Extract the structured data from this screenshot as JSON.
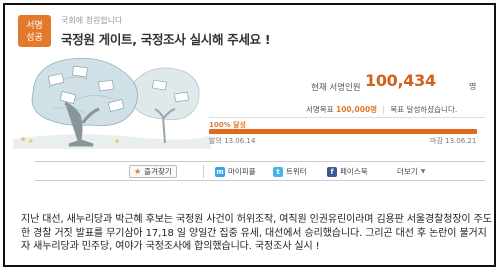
{
  "header": {
    "badge_line1": "서명",
    "badge_line2": "성공",
    "subtitle": "국회에 청원합니다",
    "title": "국정원 게이트, 국정조사 실시해 주세요 !"
  },
  "stats": {
    "count_label": "현재 서명인원",
    "count_value": "100,434",
    "count_unit": "명",
    "goal_label": "서명목표",
    "goal_value": "100,000명",
    "goal_status": "목표 달성하셨습니다.",
    "progress_label": "100% 달성",
    "progress_fraction": 1.0,
    "start_label": "발의",
    "start_date": "13.06.14",
    "end_label": "마감",
    "end_date": "13.06.21"
  },
  "social": {
    "favorite": "즐겨찾기",
    "me2day": "마이피플",
    "twitter": "트위터",
    "facebook": "페이스북",
    "more": "더보기",
    "colors": {
      "me2day": "#3aa3e3",
      "twitter": "#44b6e8",
      "facebook": "#3b5998"
    }
  },
  "content": {
    "text": "지난 대선, 새누리당과 박근혜 후보는 국정원 사건이 허위조작, 여직원 인권유린이라며 김용판 서울경찰청장이 주도한 경찰 거짓 발표를 무기삼아 17,18 일 양일간 집중 유세, 대선에서 승리했습니다. 그리곤 대선 후 논란이 불거지자 새누리당과 민주당, 여야가 국정조사에 합의했습니다. 국정조사 실시 !"
  },
  "colors": {
    "accent": "#e2792b",
    "count": "#d4601d"
  }
}
